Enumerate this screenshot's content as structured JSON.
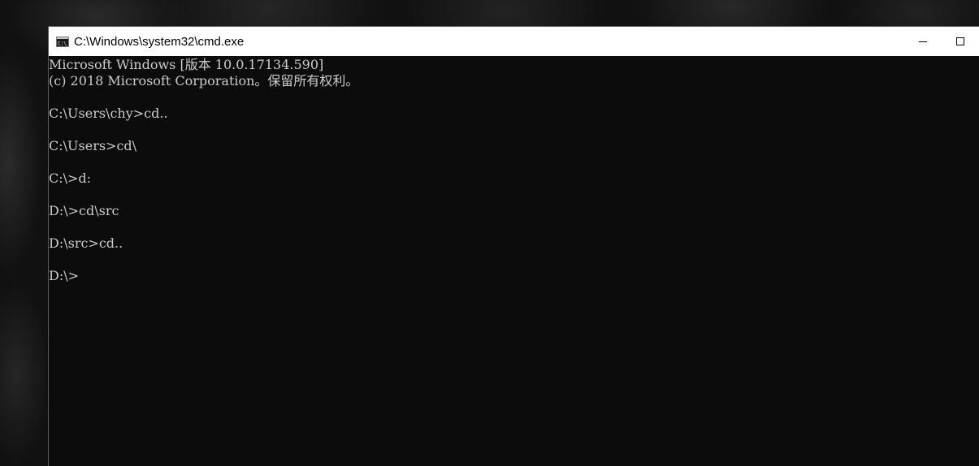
{
  "window": {
    "title": "C:\\Windows\\system32\\cmd.exe",
    "app_icon": "cmd-icon",
    "controls": [
      "minimize-icon",
      "maximize-icon"
    ]
  },
  "console": {
    "lines": [
      "Microsoft Windows [版本 10.0.17134.590]",
      "(c) 2018 Microsoft Corporation。保留所有权利。",
      "",
      "C:\\Users\\chy>cd..",
      "",
      "C:\\Users>cd\\",
      "",
      "C:\\>d:",
      "",
      "D:\\>cd\\src",
      "",
      "D:\\src>cd..",
      "",
      "D:\\>"
    ]
  },
  "colors": {
    "console_bg": "#0c0c0c",
    "console_text": "#cccccc",
    "titlebar_bg": "#ffffff"
  }
}
